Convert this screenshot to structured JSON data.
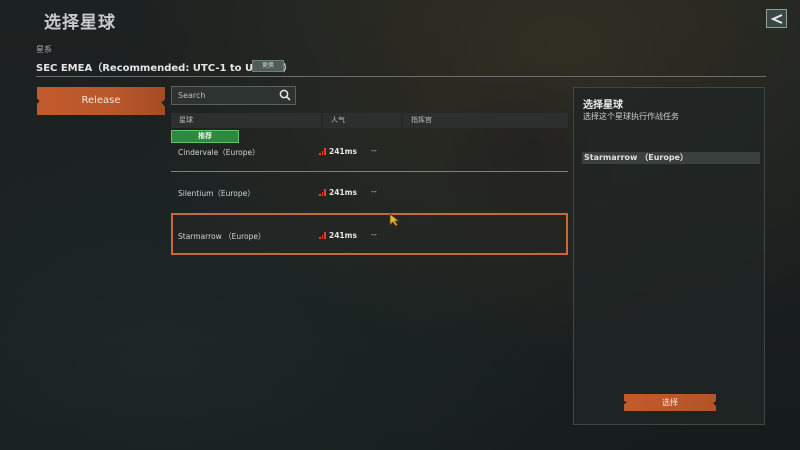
{
  "header": {
    "title": "选择星球",
    "back_icon": "back-arrow-icon"
  },
  "region": {
    "label": "星系",
    "name": "SEC EMEA（Recommended: UTC-1 to UTC+5）",
    "change_label": "更换"
  },
  "tabs": [
    {
      "label": "Release",
      "active": true
    }
  ],
  "search": {
    "placeholder": "Search"
  },
  "table": {
    "columns": [
      "星球",
      "人气",
      "指挥官"
    ],
    "recommend_badge": "推荐",
    "rows": [
      {
        "name": "Cindervale（Europe）",
        "ping": "241ms",
        "commander": "--",
        "recommended": true
      },
      {
        "name": "Silentium（Europe）",
        "ping": "241ms",
        "commander": "--"
      },
      {
        "name": "Starmarrow （Europe）",
        "ping": "241ms",
        "commander": "--",
        "selected": true
      }
    ]
  },
  "detail": {
    "title": "选择星球",
    "subtitle": "选择这个星球执行作战任务",
    "selected_name": "Starmarrow （Europe）",
    "confirm_label": "选择"
  },
  "colors": {
    "accent": "#c25a2c",
    "recommend_green": "#2d8a3a",
    "ping_red": "#e2412f"
  }
}
